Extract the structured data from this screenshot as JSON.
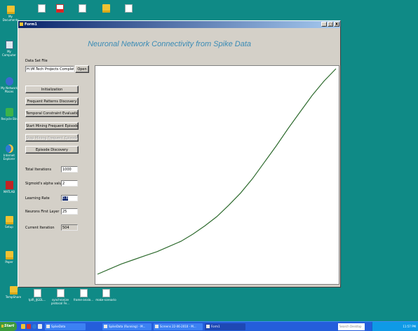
{
  "desktop": {
    "icons": [
      {
        "label": "My Documents",
        "icon": "folder-icon"
      },
      {
        "label": "",
        "icon": "document-icon"
      },
      {
        "label": "",
        "icon": "pdf-icon"
      },
      {
        "label": "",
        "icon": "document-icon"
      },
      {
        "label": "",
        "icon": "folder-icon"
      },
      {
        "label": "",
        "icon": "document-icon"
      },
      {
        "label": "My Computer",
        "icon": "computer-icon"
      },
      {
        "label": "My Network Places",
        "icon": "network-icon"
      },
      {
        "label": "Recycle Bin",
        "icon": "recycle-bin-icon"
      },
      {
        "label": "Internet Explorer",
        "icon": "ie-icon"
      },
      {
        "label": "MATLAB",
        "icon": "app-icon"
      },
      {
        "label": "Setup",
        "icon": "folder-icon"
      },
      {
        "label": "Paper",
        "icon": "folder-icon"
      },
      {
        "label": "TempShare",
        "icon": "folder-icon"
      },
      {
        "label": "tpIR_IJGDL...",
        "icon": "document-icon"
      },
      {
        "label": "synchronize protocol Fe...",
        "icon": "document-icon"
      },
      {
        "label": "frame-analo...",
        "icon": "document-icon"
      },
      {
        "label": "make-scenario",
        "icon": "document-icon"
      }
    ]
  },
  "window": {
    "title": "Form1",
    "controls": [
      "_",
      "□",
      "X"
    ],
    "app_title": "Neuronal Network Connectivity from Spike Data",
    "data_set_label": "Data Set File",
    "data_set_value": "H:\\M.Tech Projects Completed",
    "open_label": "Open",
    "buttons": {
      "initialization": "Initialization",
      "frequent_patterns": "Frequent Patterns Discovery",
      "temporal_constraint": "Temporal Constraint Evaluation",
      "start_mining": "Start Mining Frequent Episodes",
      "stop_mining": "Stop Mining Frequent Episodes",
      "episode_discovery": "Episode Discovery"
    },
    "fields": {
      "total_iterations_label": "Total Iterations",
      "total_iterations_value": "1000",
      "sigmoid_label": "Sigmoid's alpha value",
      "sigmoid_value": "2",
      "learning_rate_label": "Learning Rate",
      "learning_rate_value": "0.8",
      "neurons_label": "Neurons First Layer",
      "neurons_value": "25",
      "current_iteration_label": "Current Iteration",
      "current_iteration_value": "504"
    }
  },
  "chart_data": {
    "type": "line",
    "title": "",
    "xlabel": "",
    "ylabel": "",
    "grid": false,
    "color": "#2e6b2e",
    "series": [
      {
        "x": [
          0,
          0.05,
          0.1,
          0.15,
          0.2,
          0.25,
          0.3,
          0.35,
          0.4,
          0.45,
          0.5,
          0.55,
          0.6,
          0.65,
          0.7,
          0.75,
          0.8,
          0.85,
          0.9,
          0.95,
          1.0
        ],
        "y": [
          0,
          0.025,
          0.05,
          0.07,
          0.09,
          0.11,
          0.135,
          0.16,
          0.195,
          0.235,
          0.28,
          0.335,
          0.395,
          0.465,
          0.545,
          0.625,
          0.71,
          0.79,
          0.87,
          0.94,
          1.0
        ]
      }
    ]
  },
  "taskbar": {
    "start_label": "Start",
    "tasks": [
      {
        "label": "SpikeData",
        "active": false
      },
      {
        "label": "SpikeData (Running) - M...",
        "active": false
      },
      {
        "label": "Screens 22-06-2010 - M...",
        "active": false
      },
      {
        "label": "Form1",
        "active": true
      }
    ],
    "search_placeholder": "Search Desktop",
    "clock": "11:57 PM"
  }
}
